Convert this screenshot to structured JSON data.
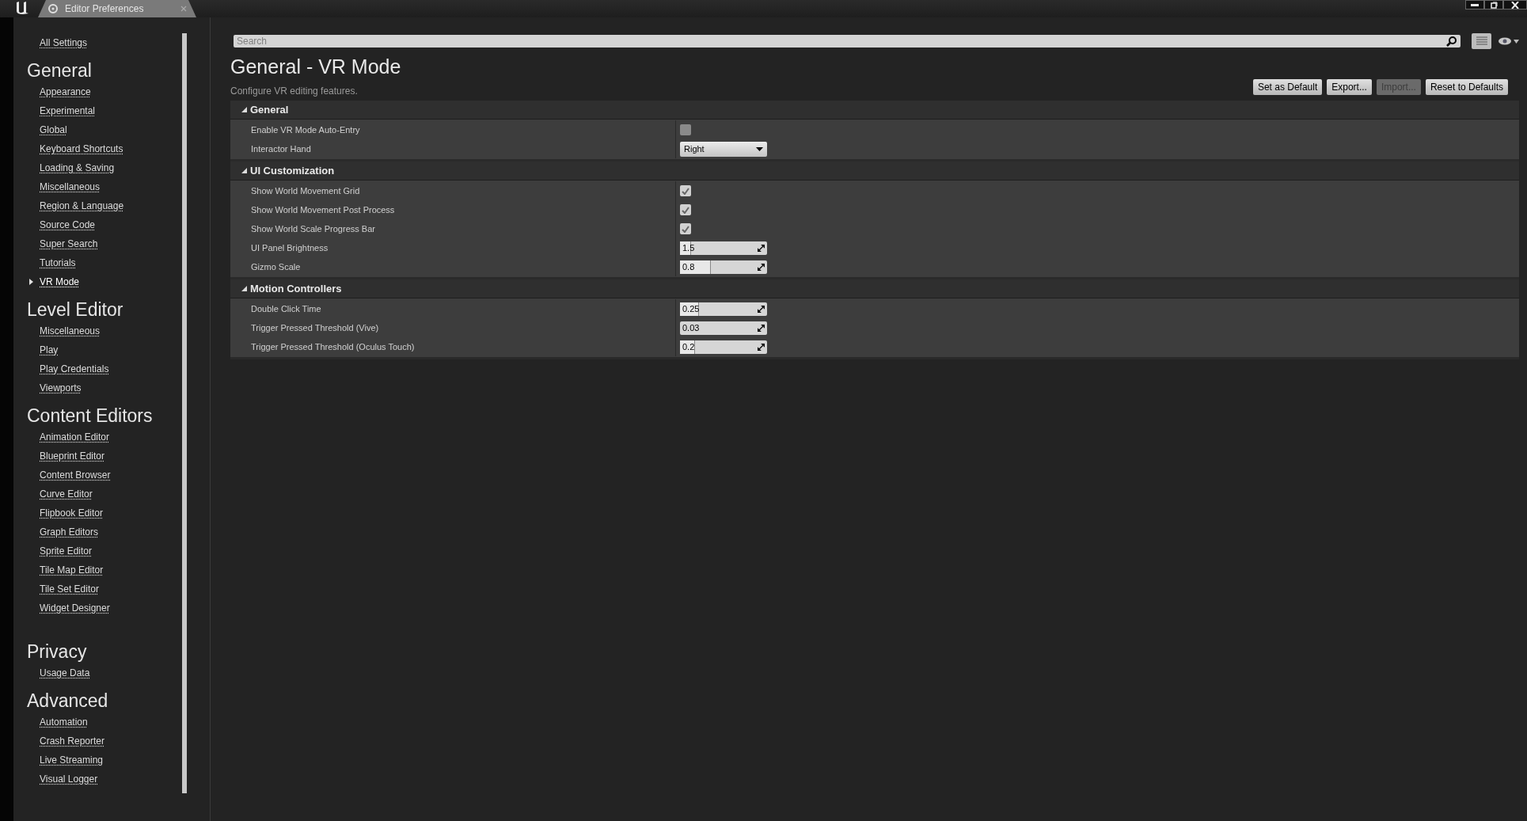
{
  "window": {
    "tab_title": "Editor Preferences"
  },
  "sidebar": {
    "all_settings": "All Settings",
    "groups": [
      {
        "title": "General",
        "items": [
          {
            "label": "Appearance",
            "selected": false
          },
          {
            "label": "Experimental",
            "selected": false
          },
          {
            "label": "Global",
            "selected": false
          },
          {
            "label": "Keyboard Shortcuts",
            "selected": false
          },
          {
            "label": "Loading & Saving",
            "selected": false
          },
          {
            "label": "Miscellaneous",
            "selected": false
          },
          {
            "label": "Region & Language",
            "selected": false
          },
          {
            "label": "Source Code",
            "selected": false
          },
          {
            "label": "Super Search",
            "selected": false
          },
          {
            "label": "Tutorials",
            "selected": false
          },
          {
            "label": "VR Mode",
            "selected": true
          }
        ]
      },
      {
        "title": "Level Editor",
        "items": [
          {
            "label": "Miscellaneous",
            "selected": false
          },
          {
            "label": "Play",
            "selected": false
          },
          {
            "label": "Play Credentials",
            "selected": false
          },
          {
            "label": "Viewports",
            "selected": false
          }
        ]
      },
      {
        "title": "Content Editors",
        "items": [
          {
            "label": "Animation Editor",
            "selected": false
          },
          {
            "label": "Blueprint Editor",
            "selected": false
          },
          {
            "label": "Content Browser",
            "selected": false
          },
          {
            "label": "Curve Editor",
            "selected": false
          },
          {
            "label": "Flipbook Editor",
            "selected": false
          },
          {
            "label": "Graph Editors",
            "selected": false
          },
          {
            "label": "Sprite Editor",
            "selected": false
          },
          {
            "label": "Tile Map Editor",
            "selected": false
          },
          {
            "label": "Tile Set Editor",
            "selected": false
          },
          {
            "label": "Widget Designer",
            "selected": false
          }
        ]
      },
      {
        "title": "Privacy",
        "items": [
          {
            "label": "Usage Data",
            "selected": false
          }
        ]
      },
      {
        "title": "Advanced",
        "items": [
          {
            "label": "Automation",
            "selected": false
          },
          {
            "label": "Crash Reporter",
            "selected": false
          },
          {
            "label": "Live Streaming",
            "selected": false
          },
          {
            "label": "Visual Logger",
            "selected": false
          }
        ]
      }
    ]
  },
  "search": {
    "placeholder": "Search"
  },
  "page": {
    "title": "General - VR Mode",
    "description": "Configure VR editing features."
  },
  "buttons": [
    {
      "label": "Set as Default",
      "disabled": false
    },
    {
      "label": "Export...",
      "disabled": false
    },
    {
      "label": "Import...",
      "disabled": true
    },
    {
      "label": "Reset to Defaults",
      "disabled": false
    }
  ],
  "sections": [
    {
      "title": "General",
      "expanded": true,
      "rows": [
        {
          "kind": "checkbox",
          "label": "Enable VR Mode Auto-Entry",
          "checked": false
        },
        {
          "kind": "dropdown",
          "label": "Interactor Hand",
          "value": "Right"
        }
      ]
    },
    {
      "title": "UI Customization",
      "expanded": true,
      "rows": [
        {
          "kind": "checkbox",
          "label": "Show World Movement Grid",
          "checked": true
        },
        {
          "kind": "checkbox",
          "label": "Show World Movement Post Process",
          "checked": true
        },
        {
          "kind": "checkbox",
          "label": "Show World Scale Progress Bar",
          "checked": true
        },
        {
          "kind": "spinbox",
          "label": "UI Panel Brightness",
          "value": "1.5",
          "level": 0.13
        },
        {
          "kind": "spinbox",
          "label": "Gizmo Scale",
          "value": "0.8",
          "level": 0.35
        }
      ]
    },
    {
      "title": "Motion Controllers",
      "expanded": true,
      "rows": [
        {
          "kind": "spinbox",
          "label": "Double Click Time",
          "value": "0.25",
          "level": 0.22
        },
        {
          "kind": "spinbox",
          "label": "Trigger Pressed Threshold (Vive)",
          "value": "0.03"
        },
        {
          "kind": "spinbox",
          "label": "Trigger Pressed Threshold (Oculus Touch)",
          "value": "0.2",
          "level": 0.17
        }
      ]
    }
  ]
}
